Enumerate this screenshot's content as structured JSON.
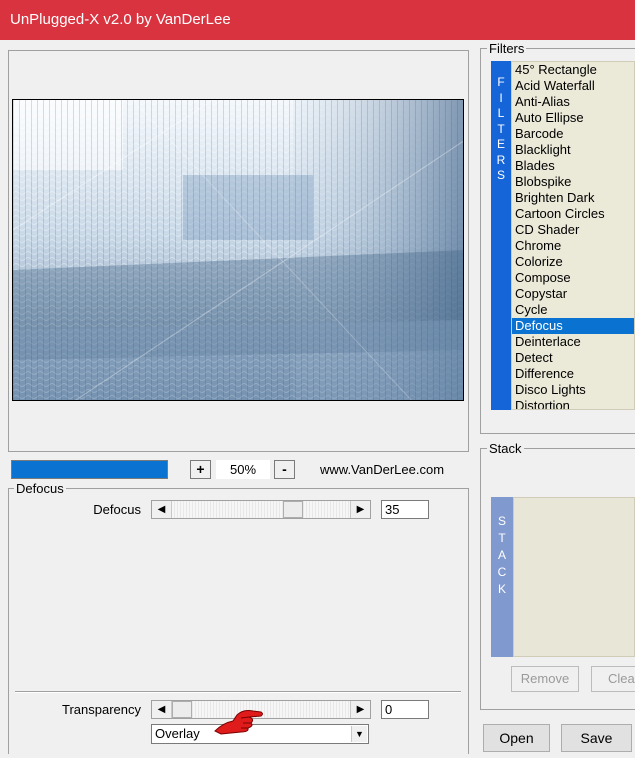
{
  "window": {
    "title": "UnPlugged-X v2.0 by VanDerLee"
  },
  "zoom": {
    "plus_label": "+",
    "value": "50%",
    "minus_label": "-"
  },
  "website": "www.VanDerLee.com",
  "defocus_group": {
    "legend": "Defocus",
    "param_label": "Defocus",
    "param_value": "35",
    "slider_level_pct": 70
  },
  "transparency": {
    "label": "Transparency",
    "value": "0",
    "slider_level_pct": 0
  },
  "blend_mode": {
    "selected": "Overlay"
  },
  "filters": {
    "legend": "Filters",
    "tab_label": "FILTERS",
    "items": [
      "45° Rectangle",
      "Acid Waterfall",
      "Anti-Alias",
      "Auto Ellipse",
      "Barcode",
      "Blacklight",
      "Blades",
      "Blobspike",
      "Brighten Dark",
      "Cartoon Circles",
      "CD Shader",
      "Chrome",
      "Colorize",
      "Compose",
      "Copystar",
      "Cycle",
      "Defocus",
      "Deinterlace",
      "Detect",
      "Difference",
      "Disco Lights",
      "Distortion"
    ],
    "selected": "Defocus"
  },
  "stack": {
    "legend": "Stack",
    "tab_label": "STACK",
    "remove_label": "Remove",
    "clear_label": "Clear"
  },
  "buttons": {
    "open_label": "Open",
    "save_label": "Save"
  },
  "colors": {
    "titlebar": "#d9333f",
    "accent": "#0a73d2",
    "filters_tab": "#1564d8",
    "stack_tab": "#8099cf"
  },
  "icons": {
    "pointer": "pointing-hand-icon"
  }
}
